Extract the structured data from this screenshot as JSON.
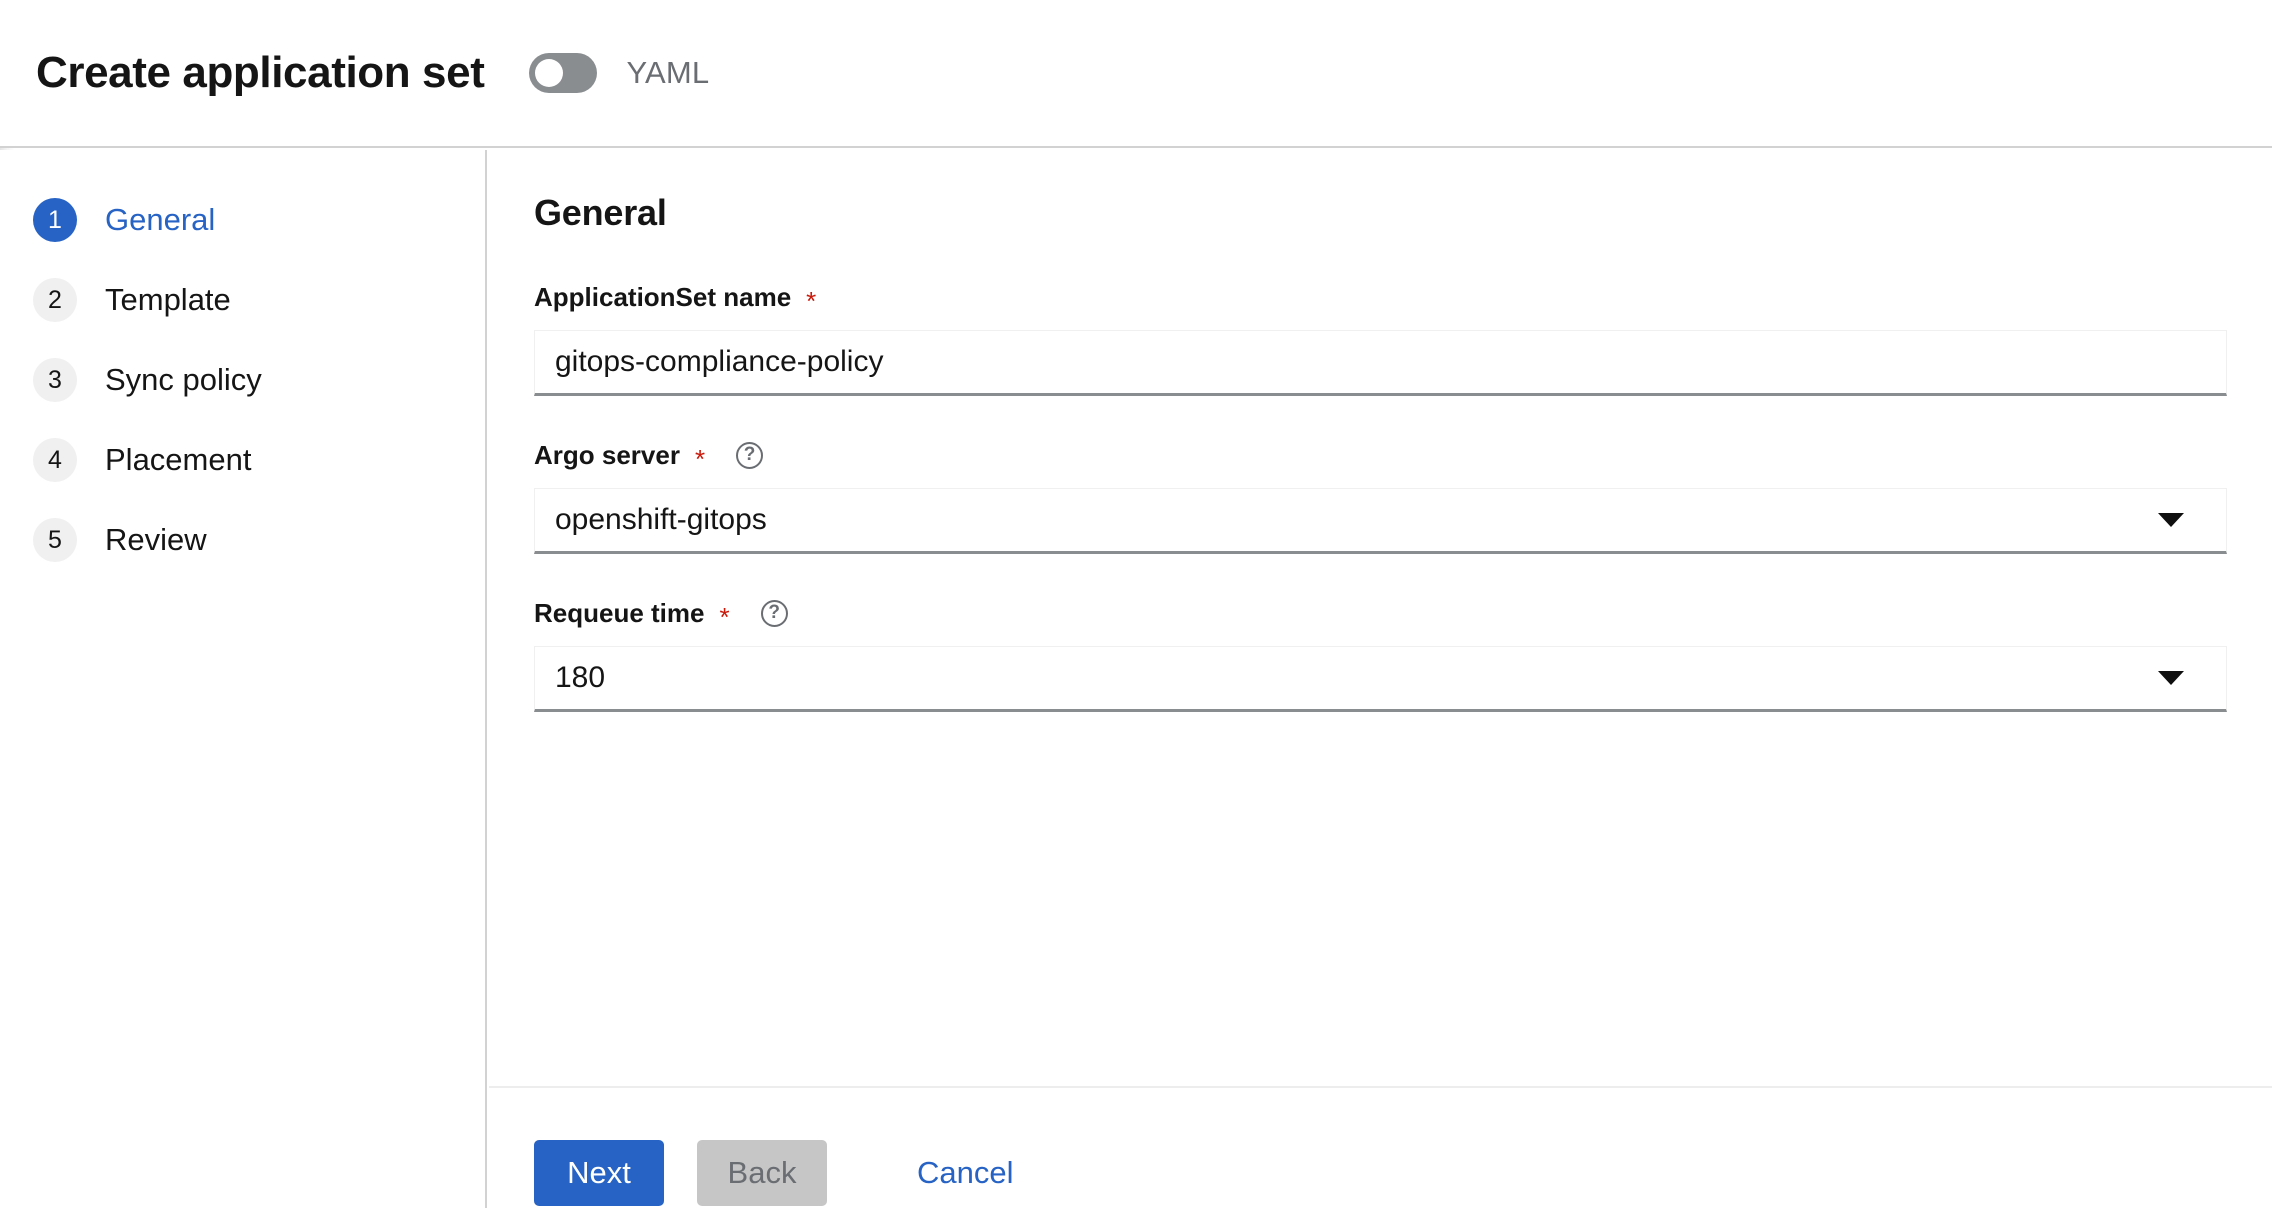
{
  "header": {
    "title": "Create application set",
    "yaml_toggle_label": "YAML",
    "yaml_toggle_state": "off"
  },
  "sidebar": {
    "steps": [
      {
        "number": "1",
        "label": "General",
        "active": true
      },
      {
        "number": "2",
        "label": "Template",
        "active": false
      },
      {
        "number": "3",
        "label": "Sync policy",
        "active": false
      },
      {
        "number": "4",
        "label": "Placement",
        "active": false
      },
      {
        "number": "5",
        "label": "Review",
        "active": false
      }
    ]
  },
  "main": {
    "section_title": "General",
    "fields": {
      "appset_name": {
        "label": "ApplicationSet name",
        "required_marker": "*",
        "value": "gitops-compliance-policy"
      },
      "argo_server": {
        "label": "Argo server",
        "required_marker": "*",
        "help_glyph": "?",
        "value": "openshift-gitops"
      },
      "requeue_time": {
        "label": "Requeue time",
        "required_marker": "*",
        "help_glyph": "?",
        "value": "180"
      }
    }
  },
  "footer": {
    "next_label": "Next",
    "back_label": "Back",
    "cancel_label": "Cancel"
  },
  "colors": {
    "accent_blue": "#2763c4",
    "required_red": "#c9190b",
    "muted_grey": "#6a6e73",
    "disabled_grey": "#c6c6c6",
    "toggle_off": "#8a8d90"
  }
}
